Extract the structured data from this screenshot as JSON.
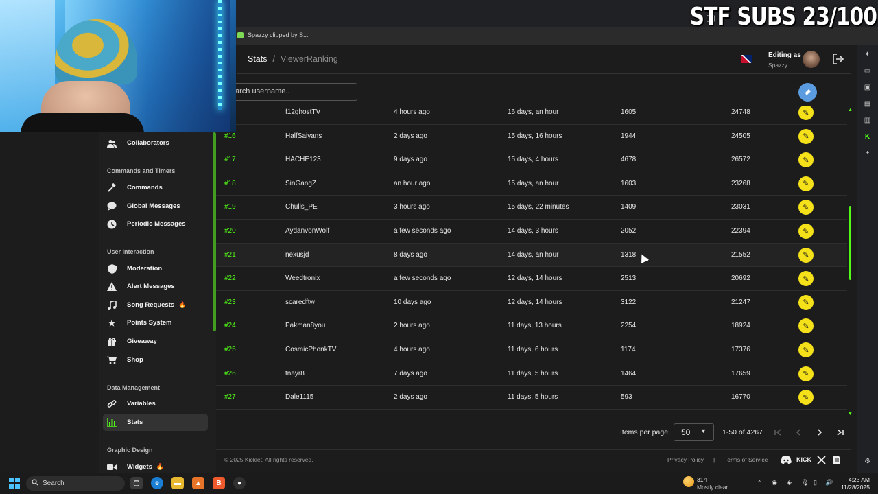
{
  "overlay": {
    "text": "STF SUBS 23/100"
  },
  "bookmarks": [
    {
      "label": "Spazzy clipped by S..."
    }
  ],
  "header": {
    "breadcrumb_root": "Stats",
    "breadcrumb_sep": "/",
    "breadcrumb_current": "ViewerRanking",
    "editing_label": "Editing as",
    "editing_user": "Spazzy"
  },
  "search": {
    "placeholder": "arch username.."
  },
  "sidebar": {
    "items_top": [
      {
        "label": "Collaborators",
        "icon": "people-icon"
      }
    ],
    "sections": [
      {
        "title": "Commands and Timers",
        "items": [
          {
            "label": "Commands",
            "icon": "gavel-icon"
          },
          {
            "label": "Global Messages",
            "icon": "chat-bubble-icon"
          },
          {
            "label": "Periodic Messages",
            "icon": "clock-icon"
          }
        ]
      },
      {
        "title": "User Interaction",
        "items": [
          {
            "label": "Moderation",
            "icon": "shield-icon"
          },
          {
            "label": "Alert Messages",
            "icon": "warning-icon"
          },
          {
            "label": "Song Requests",
            "icon": "music-note-icon",
            "badge": "flame"
          },
          {
            "label": "Points System",
            "icon": "star-icon"
          },
          {
            "label": "Giveaway",
            "icon": "gift-icon"
          },
          {
            "label": "Shop",
            "icon": "cart-icon"
          }
        ]
      },
      {
        "title": "Data Management",
        "items": [
          {
            "label": "Variables",
            "icon": "link-icon"
          },
          {
            "label": "Stats",
            "icon": "bar-chart-icon",
            "active": true
          }
        ]
      },
      {
        "title": "Graphic Design",
        "items": [
          {
            "label": "Widgets",
            "icon": "video-icon",
            "badge": "flame"
          }
        ]
      }
    ]
  },
  "table": {
    "rows": [
      {
        "rank": "",
        "name": "f12ghostTV",
        "last_seen": "4 hours ago",
        "watch_time": "16 days, an hour",
        "messages": "1605",
        "points": "24748"
      },
      {
        "rank": "#16",
        "name": "HalfSaiyans",
        "last_seen": "2 days ago",
        "watch_time": "15 days, 16 hours",
        "messages": "1944",
        "points": "24505"
      },
      {
        "rank": "#17",
        "name": "HACHE123",
        "last_seen": "9 days ago",
        "watch_time": "15 days, 4 hours",
        "messages": "4678",
        "points": "26572"
      },
      {
        "rank": "#18",
        "name": "SinGangZ",
        "last_seen": "an hour ago",
        "watch_time": "15 days, an hour",
        "messages": "1603",
        "points": "23268"
      },
      {
        "rank": "#19",
        "name": "Chulls_PE",
        "last_seen": "3 hours ago",
        "watch_time": "15 days, 22 minutes",
        "messages": "1409",
        "points": "23031"
      },
      {
        "rank": "#20",
        "name": "AydanvonWolf",
        "last_seen": "a few seconds ago",
        "watch_time": "14 days, 3 hours",
        "messages": "2052",
        "points": "22394"
      },
      {
        "rank": "#21",
        "name": "nexusjd",
        "last_seen": "8 days ago",
        "watch_time": "14 days, an hour",
        "messages": "1318",
        "points": "21552"
      },
      {
        "rank": "#22",
        "name": "Weedtronix",
        "last_seen": "a few seconds ago",
        "watch_time": "12 days, 14 hours",
        "messages": "2513",
        "points": "20692"
      },
      {
        "rank": "#23",
        "name": "scaredftw",
        "last_seen": "10 days ago",
        "watch_time": "12 days, 14 hours",
        "messages": "3122",
        "points": "21247"
      },
      {
        "rank": "#24",
        "name": "Pakman8you",
        "last_seen": "2 hours ago",
        "watch_time": "11 days, 13 hours",
        "messages": "2254",
        "points": "18924"
      },
      {
        "rank": "#25",
        "name": "CosmicPhonkTV",
        "last_seen": "4 hours ago",
        "watch_time": "11 days, 6 hours",
        "messages": "1174",
        "points": "17376"
      },
      {
        "rank": "#26",
        "name": "tnayr8",
        "last_seen": "7 days ago",
        "watch_time": "11 days, 5 hours",
        "messages": "1464",
        "points": "17659"
      },
      {
        "rank": "#27",
        "name": "Dale1115",
        "last_seen": "2 days ago",
        "watch_time": "11 days, 5 hours",
        "messages": "593",
        "points": "16770"
      }
    ]
  },
  "pagination": {
    "items_per_page_label": "Items per page:",
    "items_per_page_value": "50",
    "range": "1-50 of 4267"
  },
  "footer": {
    "copyright": "© 2025 Kicklet. All rights reserved.",
    "privacy": "Privacy Policy",
    "sep": "|",
    "terms": "Terms of Service",
    "kick_text": "KICK"
  },
  "taskbar": {
    "search_label": "Search",
    "weather_temp": "31°F",
    "weather_desc": "Mostly clear",
    "time": "4:23 AM",
    "date": "11/28/2025"
  },
  "colors": {
    "accent_green": "#53fc18",
    "edit_yellow": "#f5e11a",
    "eraser_blue": "#5b9be0"
  }
}
